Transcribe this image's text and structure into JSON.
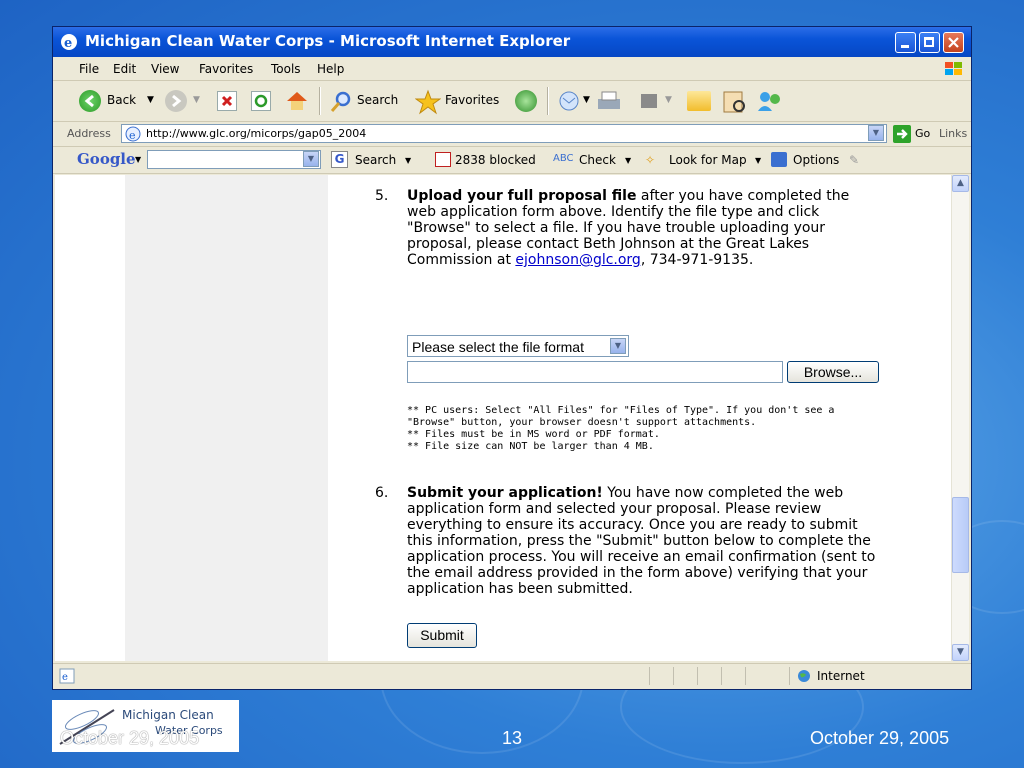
{
  "window": {
    "title": "Michigan Clean Water Corps - Microsoft Internet Explorer"
  },
  "menu": [
    "File",
    "Edit",
    "View",
    "Favorites",
    "Tools",
    "Help"
  ],
  "toolbar": {
    "back_label": "Back",
    "search_label": "Search",
    "favorites_label": "Favorites"
  },
  "address": {
    "label": "Address",
    "url": "http://www.glc.org/micorps/gap05_2004",
    "go_label": "Go",
    "links_label": "Links"
  },
  "google_bar": {
    "brand": "Google",
    "search_label": "Search",
    "blocked_label": "2838 blocked",
    "check_label": "Check",
    "lookformap_label": "Look for Map",
    "options_label": "Options"
  },
  "page": {
    "step5": {
      "number": "5.",
      "bold": "Upload your full proposal file",
      "text1": " after you have completed the web application form above.  Identify the file type and click \"Browse\" to select a file.  If you have trouble uploading your proposal, please contact Beth Johnson at the Great Lakes Commission at ",
      "email": "ejohnson@glc.org",
      "text2": ", 734-971-9135."
    },
    "format_select": "Please select the file format",
    "browse_label": "Browse...",
    "notes": [
      "** PC users: Select \"All Files\" for \"Files of Type\". If you don't see a",
      "\"Browse\" button, your browser doesn't support attachments.",
      "** Files must be in MS word or PDF format.",
      "** File size can NOT be larger than 4 MB."
    ],
    "step6": {
      "number": "6.",
      "bold": "Submit your application!",
      "text": " You have now completed the web application form and selected your proposal. Please review everything to ensure its accuracy. Once you are ready to submit this information, press the \"Submit\" button below to complete the application process. You will receive an email confirmation (sent to the email address provided in the form above) verifying that your application has been submitted."
    },
    "submit_label": "Submit"
  },
  "status": {
    "zone": "Internet"
  },
  "slide": {
    "logo_line1": "Michigan Clean",
    "logo_line2": "Water Corps",
    "date_left": "October 29, 2005",
    "page_number": "13",
    "date_right": "October 29, 2005"
  },
  "colors": {
    "background": "#2f7fd6",
    "titlebar": "#0a54d8",
    "link": "#0000cc"
  }
}
